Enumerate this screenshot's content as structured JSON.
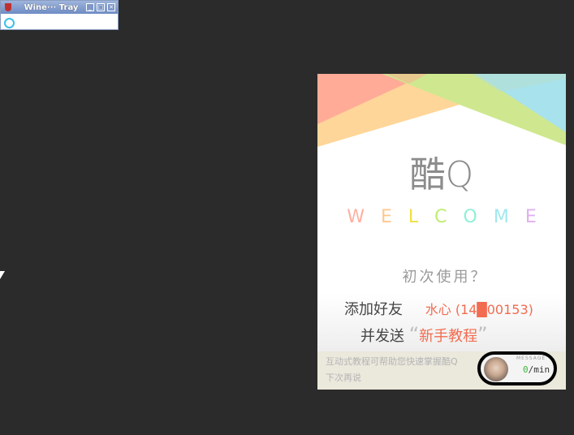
{
  "tray": {
    "title": "Wine··· Tray",
    "minimize": "_",
    "maximize": "□",
    "close": "✕"
  },
  "card": {
    "logo": "酷Q",
    "welcome_letters": [
      "W",
      "E",
      "L",
      "C",
      "O",
      "M",
      "E"
    ],
    "welcome_colors": [
      "#ffb0a0",
      "#ffc890",
      "#f0e040",
      "#c0ec70",
      "#90f0d8",
      "#a0e8f0",
      "#e0b0f0"
    ],
    "first_use": "初次使用？",
    "add_friend": "添加好友",
    "friend": "水心 (14█00153)",
    "send": "并发送",
    "quote_open": "“",
    "tutorial": "新手教程",
    "quote_close": "”",
    "tip": "互动式教程可帮助您快速掌握酷Q",
    "later": "下次再说",
    "message_label": "MESSAGE",
    "message_count": "0",
    "message_unit": "/min",
    "accent": "#f26c50"
  }
}
